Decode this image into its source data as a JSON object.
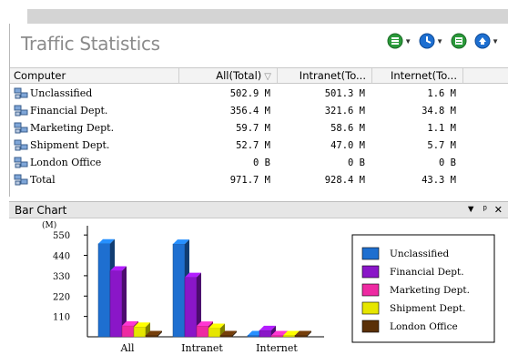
{
  "traffic": {
    "title": "Traffic Statistics",
    "toolbar": [
      {
        "icon": "grid-view-icon",
        "color": "#2a9a3a"
      },
      {
        "icon": "clock-icon",
        "color": "#1d6fd1"
      },
      {
        "icon": "list-report-icon",
        "color": "#2a9a3a"
      },
      {
        "icon": "upload-icon",
        "color": "#1d6fd1"
      }
    ],
    "columns": {
      "computer": "Computer",
      "all": "All(Total)",
      "intranet": "Intranet(To...",
      "internet": "Internet(To..."
    },
    "rows": [
      {
        "name": "Unclassified",
        "all": "502.9 M",
        "intranet": "501.3 M",
        "internet": "1.6 M"
      },
      {
        "name": "Financial Dept.",
        "all": "356.4 M",
        "intranet": "321.6 M",
        "internet": "34.8 M"
      },
      {
        "name": "Marketing Dept.",
        "all": "59.7 M",
        "intranet": "58.6 M",
        "internet": "1.1 M"
      },
      {
        "name": "Shipment Dept.",
        "all": "52.7 M",
        "intranet": "47.0 M",
        "internet": "5.7 M"
      },
      {
        "name": "London Office",
        "all": "0 B",
        "intranet": "0 B",
        "internet": "0 B"
      },
      {
        "name": "Total",
        "all": "971.7 M",
        "intranet": "928.4 M",
        "internet": "43.3 M"
      }
    ]
  },
  "bar_panel": {
    "title": "Bar Chart",
    "controls": [
      "▼",
      "ᵖ",
      "✕"
    ]
  },
  "chart_data": {
    "type": "bar",
    "ylabel": "(M)",
    "ylim": [
      0,
      600
    ],
    "yticks": [
      110,
      220,
      330,
      440,
      550
    ],
    "categories": [
      "All",
      "Intranet",
      "Internet"
    ],
    "series": [
      {
        "name": "Unclassified",
        "color": "#1e6fd0",
        "values": [
          502.9,
          501.3,
          1.6
        ]
      },
      {
        "name": "Financial Dept.",
        "color": "#8a16c8",
        "values": [
          356.4,
          321.6,
          34.8
        ]
      },
      {
        "name": "Marketing Dept.",
        "color": "#ee2aa2",
        "values": [
          59.7,
          58.6,
          1.1
        ]
      },
      {
        "name": "Shipment Dept.",
        "color": "#e6e600",
        "values": [
          52.7,
          47.0,
          5.7
        ]
      },
      {
        "name": "London Office",
        "color": "#5a3008",
        "values": [
          0,
          0,
          0
        ]
      }
    ],
    "legend": "right"
  }
}
